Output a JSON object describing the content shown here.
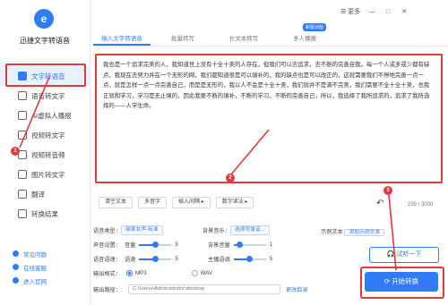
{
  "app": {
    "title": "迅捷文字转语音",
    "logo_text": "e"
  },
  "window": {
    "more_label": "更多",
    "minimize": "—",
    "close": "✕"
  },
  "sidebar": {
    "items": [
      {
        "label": "文字转语音",
        "icon": "text-to-speech-icon"
      },
      {
        "label": "语音转文字",
        "icon": "speech-to-text-icon"
      },
      {
        "label": "AI虚拟人播报",
        "icon": "ai-avatar-icon"
      },
      {
        "label": "视频转文字",
        "icon": "video-to-text-icon"
      },
      {
        "label": "视频转音频",
        "icon": "video-to-audio-icon"
      },
      {
        "label": "图片转文字",
        "icon": "image-to-text-icon"
      },
      {
        "label": "翻译",
        "icon": "translate-icon"
      },
      {
        "label": "转换结果",
        "icon": "results-icon"
      }
    ],
    "bottom": [
      {
        "label": "常见问题",
        "icon": "faq-icon"
      },
      {
        "label": "在线客服",
        "icon": "support-icon"
      },
      {
        "label": "进入官网",
        "icon": "website-icon"
      }
    ]
  },
  "tabs": [
    {
      "label": "输入文字转语音"
    },
    {
      "label": "批量转写"
    },
    {
      "label": "长文本转写"
    },
    {
      "label": "多人播报"
    }
  ],
  "tab_badge": "新版功能",
  "editor": {
    "text": "我也是一个追求完美的人，我知道世上没有十全十美的人存在，但我们可以去追求，去不断的完善自我。每一个人或多或少都有缺点，我现在去努力并在一个无形的网，我们都知道很是可以填补的，我的缺点也是可以改正的，这就需要我们不停地完善一点一点，就是怎样一点一点完善自己，而是是无形的，我以人不会是十全十美，我们就并不是满不完美，我们需要不全十全十美，也我正就和学习，学习是无止境的，因此我要不断的填补，不断的学习，不断的完善自己，所以，我选择了我所追求的，追求了我所选择的——人学生命。",
    "char_count": "239 / 3000"
  },
  "toolbar": {
    "buttons": [
      "清空文本",
      "多音字",
      "插入间隔 ▸",
      "数字读法 ▸"
    ]
  },
  "settings": {
    "voice_type_label": "语音类型：",
    "voice_type_value": "甜美女声-标准",
    "bg_music_label": "背景音乐：",
    "bg_music_value": "选择背景音...",
    "sample_label": "示例文本",
    "sample_value": "添加示例文本",
    "volume_label": "声音设置：",
    "volume_sub": "音量",
    "volume_value": "5",
    "bg_volume_sub": "背景音量",
    "bg_volume_value": "1",
    "speed_label": "语音语速：",
    "speed_sub": "语速",
    "speed_value": "5",
    "pitch_sub": "主播语调",
    "pitch_value": "5",
    "format_label": "输出格式：",
    "format_mp3": "MP3",
    "format_wav": "WAV",
    "path_label": "输出路径：",
    "path_value": "C:\\Users\\Administrator\\desktop",
    "change_dir": "更改目录",
    "volume_level": 0.5,
    "bg_volume_level": 0.2,
    "speed_level": 0.5,
    "pitch_level": 0.5
  },
  "actions": {
    "listen_label": "试听一下",
    "convert_label": "开始转换"
  },
  "markers": [
    "1",
    "2",
    "3"
  ],
  "colors": {
    "accent": "#2f7cf6",
    "annotation_red": "#e03a3a"
  }
}
